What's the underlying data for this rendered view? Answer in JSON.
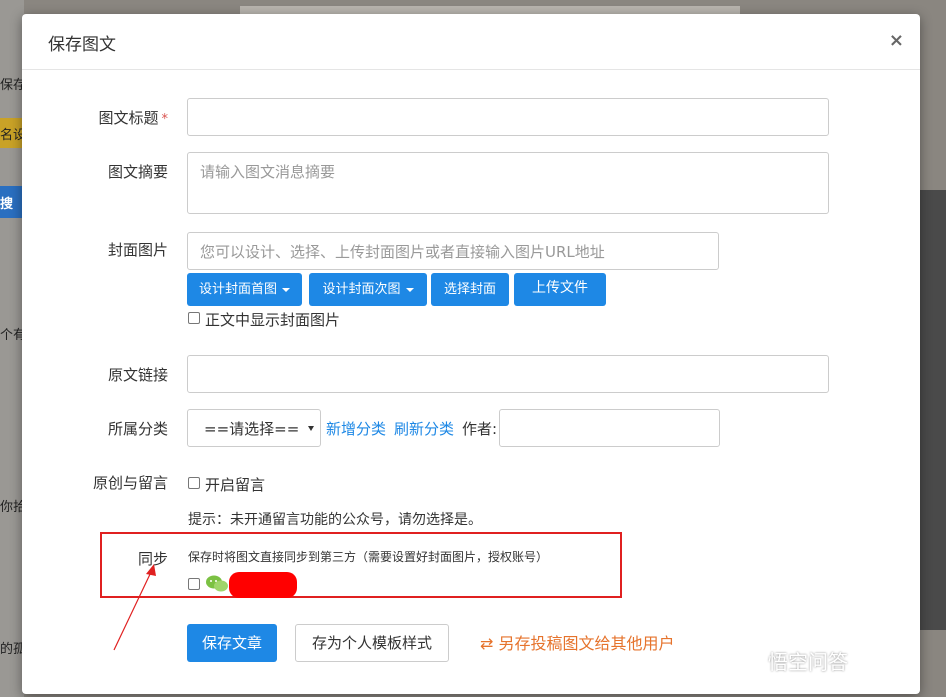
{
  "background": {
    "tabs": [
      "保存",
      "名设",
      "搜",
      "个有",
      "你拾",
      "的孤"
    ]
  },
  "modal": {
    "title": "保存图文",
    "close": "×"
  },
  "form": {
    "title_label": "图文标题",
    "required_mark": "*",
    "title_value": "",
    "summary_label": "图文摘要",
    "summary_placeholder": "请输入图文消息摘要",
    "cover_label": "封面图片",
    "cover_placeholder": "您可以设计、选择、上传封面图片或者直接输入图片URL地址",
    "buttons": {
      "design_first": "设计封面首图",
      "design_second": "设计封面次图",
      "choose_cover": "选择封面",
      "upload_file": "上传文件"
    },
    "show_cover_label": "正文中显示封面图片",
    "original_link_label": "原文链接",
    "category_label": "所属分类",
    "category_selected": "==请选择==",
    "add_category": "新增分类",
    "refresh_category": "刷新分类",
    "author_label": "作者:",
    "original_comment_label": "原创与留言",
    "enable_comment_label": "开启留言",
    "tip": "提示：未开通留言功能的公众号，请勿选择是。",
    "sync_label": "同步",
    "sync_desc": "保存时将图文直接同步到第三方（需要设置好封面图片，授权账号）"
  },
  "footer": {
    "save_article": "保存文章",
    "save_template": "存为个人模板样式",
    "transfer_icon": "⇄",
    "transfer_text": "另存投稿图文给其他用户"
  },
  "watermark": "悟空问答",
  "colors": {
    "primary": "#1e88e5",
    "highlight": "#e02020",
    "transfer": "#e6732c",
    "wechat": "#7bc143"
  }
}
